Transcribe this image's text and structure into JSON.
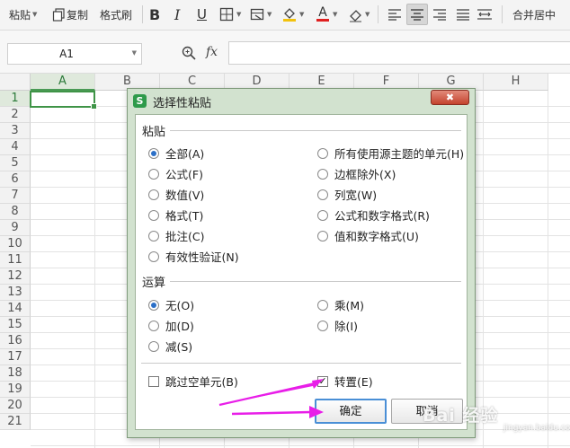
{
  "toolbar": {
    "paste": "粘贴",
    "copy": "复制",
    "format_painter": "格式刷",
    "merge_center": "合并居中",
    "bold": "B",
    "italic": "I",
    "underline": "U",
    "font_color_letter": "A",
    "highlight_color": "#f2c20d",
    "font_color": "#e02020"
  },
  "formula_bar": {
    "name_box": "A1",
    "fx": "fx",
    "value": ""
  },
  "grid": {
    "columns": [
      "A",
      "B",
      "C",
      "D",
      "E",
      "F",
      "G",
      "H"
    ],
    "rows": [
      "1",
      "2",
      "3",
      "4",
      "5",
      "6",
      "7",
      "8",
      "9",
      "10",
      "11",
      "12",
      "13",
      "14",
      "15",
      "16",
      "17",
      "18",
      "19",
      "20",
      "21"
    ],
    "active_cell": "A1",
    "active_color": "#3f9447"
  },
  "dialog": {
    "title": "选择性粘贴",
    "logo_letter": "S",
    "close": "✖",
    "paste_group": {
      "title": "粘贴",
      "left": [
        "全部(A)",
        "公式(F)",
        "数值(V)",
        "格式(T)",
        "批注(C)",
        "有效性验证(N)"
      ],
      "right": [
        "所有使用源主题的单元(H)",
        "边框除外(X)",
        "列宽(W)",
        "公式和数字格式(R)",
        "值和数字格式(U)"
      ],
      "selected": "全部(A)"
    },
    "operation_group": {
      "title": "运算",
      "left": [
        "无(O)",
        "加(D)",
        "减(S)"
      ],
      "right": [
        "乘(M)",
        "除(I)"
      ],
      "selected": "无(O)"
    },
    "skip_blanks": "跳过空单元(B)",
    "skip_blanks_checked": false,
    "transpose": "转置(E)",
    "transpose_checked": true,
    "ok": "确定",
    "cancel": "取消"
  },
  "annotation": {
    "arrow_color": "#e81ee8"
  },
  "watermark": {
    "text": "Bai 经验",
    "sub": "jingyan.baidu.com"
  }
}
